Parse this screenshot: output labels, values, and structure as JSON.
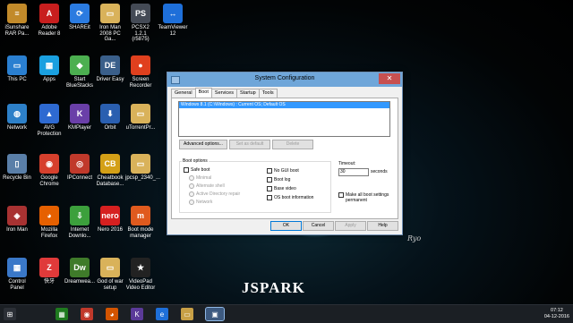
{
  "desktop": {
    "icons": [
      {
        "label": "iSunshare\nRAR Pa...",
        "glyph": "≡",
        "color": "#c28a2a",
        "col": 0,
        "row": 0
      },
      {
        "label": "Adobe\nReader 8",
        "glyph": "A",
        "color": "#c81e1e",
        "col": 1,
        "row": 0
      },
      {
        "label": "SHAREit",
        "glyph": "⟳",
        "color": "#2b7be0",
        "col": 2,
        "row": 0
      },
      {
        "label": "Iron Man\n2008 PC Ga...",
        "glyph": "▭",
        "color": "#d9b25a",
        "col": 3,
        "row": 0
      },
      {
        "label": "PCSX2 1.2.1\n(r5875)",
        "glyph": "PS",
        "color": "#444a55",
        "col": 4,
        "row": 0
      },
      {
        "label": "TeamViewer\n12",
        "glyph": "↔",
        "color": "#1e6fd9",
        "col": 5,
        "row": 0
      },
      {
        "label": "This PC",
        "glyph": "▭",
        "color": "#2a7fd0",
        "col": 0,
        "row": 1
      },
      {
        "label": "Apps",
        "glyph": "▦",
        "color": "#1aa0e0",
        "col": 1,
        "row": 1
      },
      {
        "label": "Start\nBlueStacks",
        "glyph": "◆",
        "color": "#4caf50",
        "col": 2,
        "row": 1
      },
      {
        "label": "Driver Easy",
        "glyph": "DE",
        "color": "#3a5f8a",
        "col": 3,
        "row": 1
      },
      {
        "label": "Screen\nRecorder",
        "glyph": "●",
        "color": "#e0401e",
        "col": 4,
        "row": 1
      },
      {
        "label": "Network",
        "glyph": "◍",
        "color": "#2d80c8",
        "col": 0,
        "row": 2
      },
      {
        "label": "AVG\nProtection",
        "glyph": "▲",
        "color": "#2e6ad1",
        "col": 1,
        "row": 2
      },
      {
        "label": "KMPlayer",
        "glyph": "K",
        "color": "#6a3fa8",
        "col": 2,
        "row": 2
      },
      {
        "label": "Orbit",
        "glyph": "⬇",
        "color": "#2a5fb0",
        "col": 3,
        "row": 2
      },
      {
        "label": "uTorrentPr...",
        "glyph": "▭",
        "color": "#d9b25a",
        "col": 4,
        "row": 2
      },
      {
        "label": "Recycle Bin",
        "glyph": "▯",
        "color": "#5a7fa8",
        "col": 0,
        "row": 3
      },
      {
        "label": "Google\nChrome",
        "glyph": "◉",
        "color": "#d6402d",
        "col": 1,
        "row": 3
      },
      {
        "label": "IPConnect",
        "glyph": "◎",
        "color": "#c0392b",
        "col": 2,
        "row": 3
      },
      {
        "label": "Cheatbook\nDatabase...",
        "glyph": "CB",
        "color": "#d4a017",
        "col": 3,
        "row": 3
      },
      {
        "label": "jpcsp_2340_...",
        "glyph": "▭",
        "color": "#d9b25a",
        "col": 4,
        "row": 3
      },
      {
        "label": "Iron Man",
        "glyph": "◈",
        "color": "#a83232",
        "col": 0,
        "row": 4
      },
      {
        "label": "Mozilla\nFirefox",
        "glyph": "◕",
        "color": "#e66000",
        "col": 1,
        "row": 4
      },
      {
        "label": "Internet\nDownlo...",
        "glyph": "⇩",
        "color": "#3ca03c",
        "col": 2,
        "row": 4
      },
      {
        "label": "Nero 2016",
        "glyph": "nero",
        "color": "#d62020",
        "col": 3,
        "row": 4
      },
      {
        "label": "Boot mode\nmanager",
        "glyph": "m",
        "color": "#e05a1e",
        "col": 4,
        "row": 4
      },
      {
        "label": "Control\nPanel",
        "glyph": "▦",
        "color": "#3a78c8",
        "col": 0,
        "row": 5
      },
      {
        "label": "快牙",
        "glyph": "Z",
        "color": "#e03a3a",
        "col": 1,
        "row": 5
      },
      {
        "label": "Dreamwea...",
        "glyph": "Dw",
        "color": "#3f7b2a",
        "col": 2,
        "row": 5
      },
      {
        "label": "God of war\nsetup",
        "glyph": "▭",
        "color": "#d9b25a",
        "col": 3,
        "row": 5
      },
      {
        "label": "VideoPad\nVideo Editor",
        "glyph": "★",
        "color": "#222222",
        "col": 4,
        "row": 5
      }
    ],
    "brand": "JSPARK",
    "signature": "Ryo"
  },
  "dialog": {
    "title": "System Configuration",
    "close_glyph": "✕",
    "tabs": [
      "General",
      "Boot",
      "Services",
      "Startup",
      "Tools"
    ],
    "active_tab": "Boot",
    "os_entry": "Windows 8.1 (C:\\Windows) : Current OS; Default OS",
    "buttons": {
      "advanced": "Advanced options...",
      "set_default": "Set as default",
      "delete": "Delete",
      "ok": "OK",
      "cancel": "Cancel",
      "apply": "Apply",
      "help": "Help"
    },
    "boot_options": {
      "label": "Boot options",
      "safe_boot": "Safe boot",
      "minimal": "Minimal",
      "alternate_shell": "Alternate shell",
      "ad_repair": "Active Directory repair",
      "network": "Network",
      "no_gui": "No GUI boot",
      "boot_log": "Boot log",
      "base_video": "Base video",
      "os_info": "OS boot information"
    },
    "timeout": {
      "label": "Timeout:",
      "value": "30",
      "unit": "seconds"
    },
    "permanent": "Make all boot settings permanent"
  },
  "taskbar": {
    "items": [
      {
        "name": "start",
        "glyph": "⊞",
        "color": "#2b2f36"
      },
      {
        "name": "store",
        "glyph": "▦",
        "color": "#1f7a1f"
      },
      {
        "name": "chrome",
        "glyph": "◉",
        "color": "#c0392b"
      },
      {
        "name": "firefox",
        "glyph": "◕",
        "color": "#d35400"
      },
      {
        "name": "kmplayer",
        "glyph": "K",
        "color": "#5b3a99"
      },
      {
        "name": "ie",
        "glyph": "e",
        "color": "#1e6fd9"
      },
      {
        "name": "explorer",
        "glyph": "▭",
        "color": "#c8a046"
      },
      {
        "name": "msconfig",
        "glyph": "▣",
        "color": "#3d5a80"
      }
    ],
    "time": "07:12",
    "date": "04-12-2016"
  }
}
